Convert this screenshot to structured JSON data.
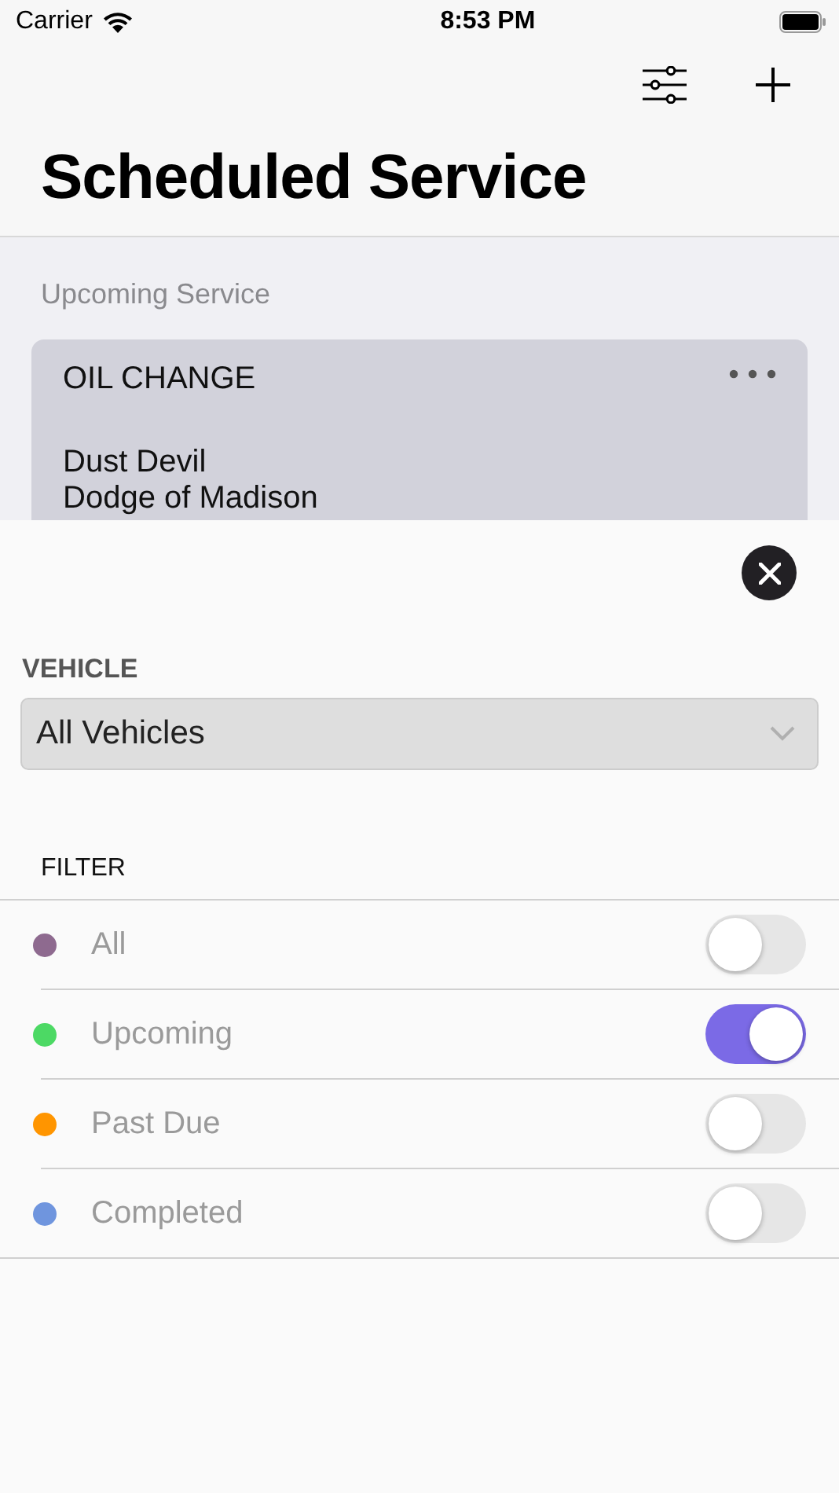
{
  "status_bar": {
    "carrier": "Carrier",
    "time": "8:53 PM"
  },
  "title": "Scheduled Service",
  "section": "Upcoming Service",
  "card": {
    "service": "OIL CHANGE",
    "vehicle": "Dust Devil",
    "dealer": "Dodge of Madison"
  },
  "sheet": {
    "vehicle_label": "VEHICLE",
    "vehicle_value": "All Vehicles",
    "filter_label": "FILTER",
    "filters": [
      {
        "label": "All",
        "color": "#8e6a8f",
        "on": false
      },
      {
        "label": "Upcoming",
        "color": "#4cd964",
        "on": true
      },
      {
        "label": "Past Due",
        "color": "#ff9500",
        "on": false
      },
      {
        "label": "Completed",
        "color": "#6f95de",
        "on": false
      }
    ]
  }
}
